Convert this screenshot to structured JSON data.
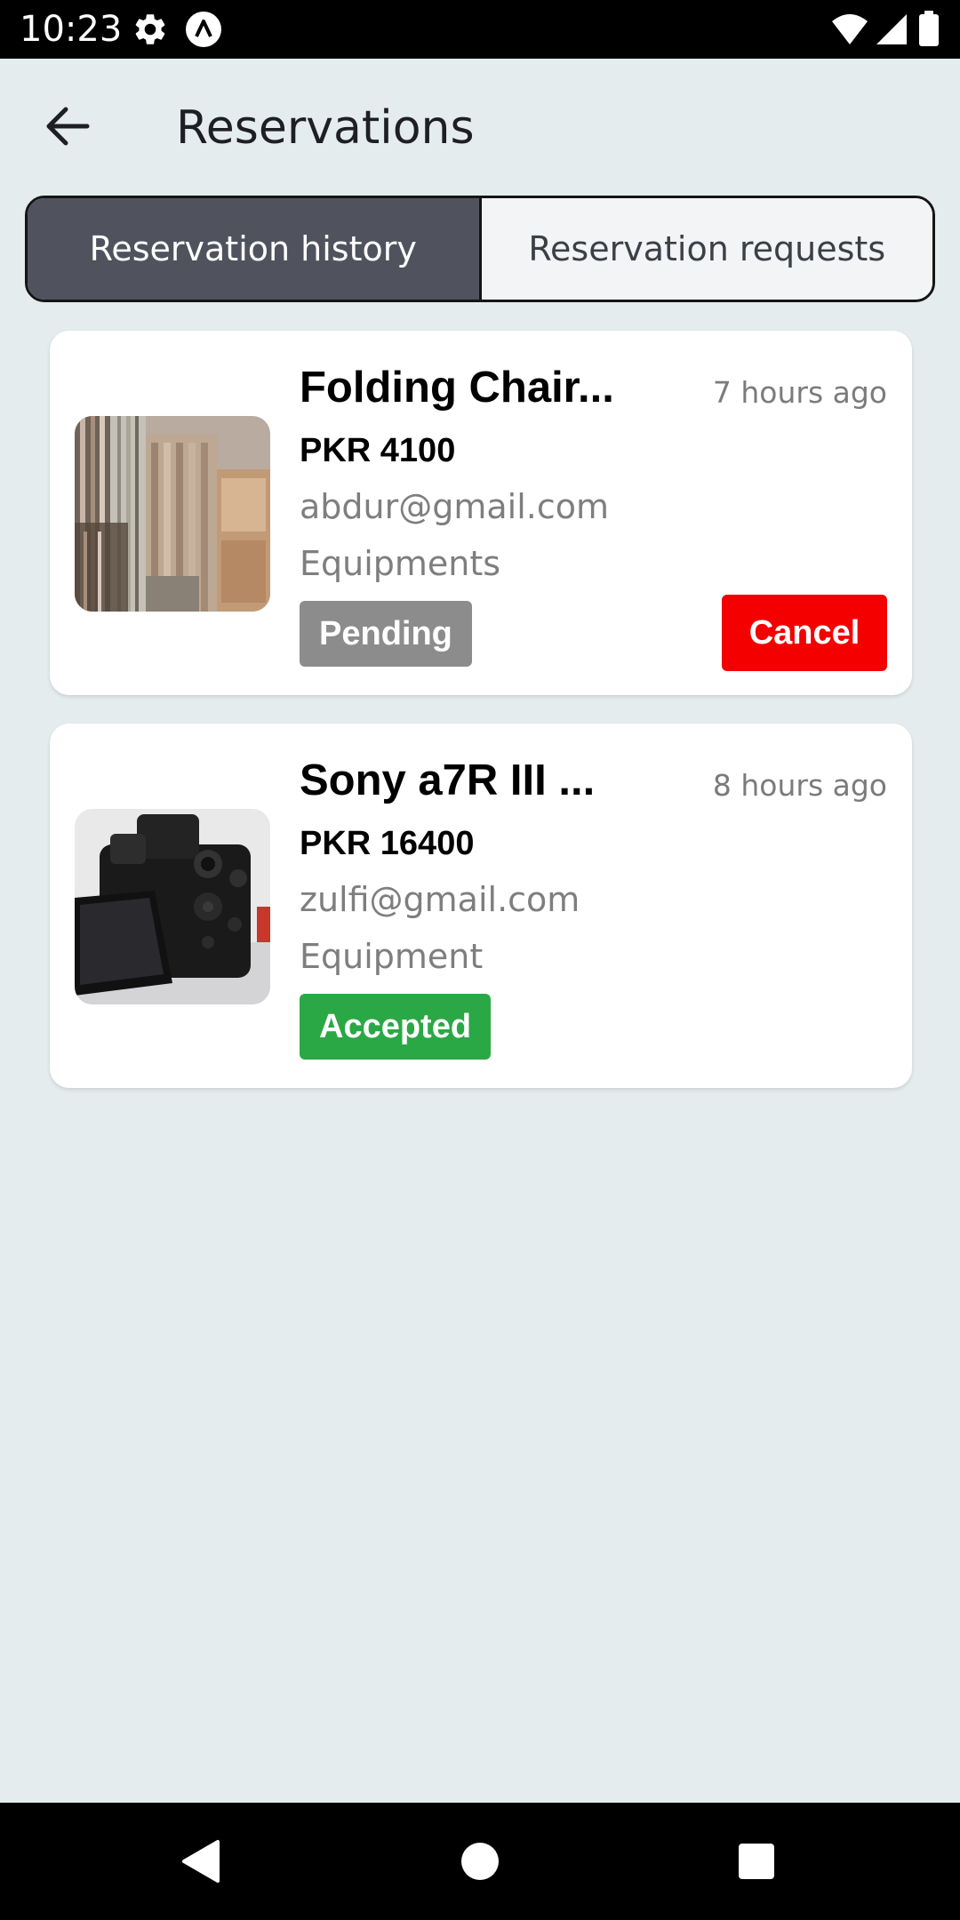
{
  "status_bar": {
    "time": "10:23",
    "icons": [
      "gear-icon",
      "a-logo-icon",
      "wifi-icon",
      "signal-icon",
      "battery-icon"
    ]
  },
  "header": {
    "title": "Reservations",
    "back_icon": "arrow-left-icon"
  },
  "tabs": [
    {
      "label": "Reservation history",
      "active": true
    },
    {
      "label": "Reservation requests",
      "active": false
    }
  ],
  "reservations": [
    {
      "title": "Folding Chair...",
      "time": "7 hours ago",
      "price": "PKR 4100",
      "email": "abdur@gmail.com",
      "category": "Equipments",
      "status": "Pending",
      "status_color": "#8c8c8c",
      "action": "Cancel",
      "action_color": "#f50000",
      "image": "folding-chairs-photo"
    },
    {
      "title": "Sony a7R III ...",
      "time": "8 hours ago",
      "price": "PKR 16400",
      "email": "zulfi@gmail.com",
      "category": "Equipment",
      "status": "Accepted",
      "status_color": "#2aa845",
      "image": "camera-photo"
    }
  ],
  "nav_bar": {
    "icons": [
      "back-triangle-icon",
      "home-circle-icon",
      "recents-square-icon"
    ]
  }
}
